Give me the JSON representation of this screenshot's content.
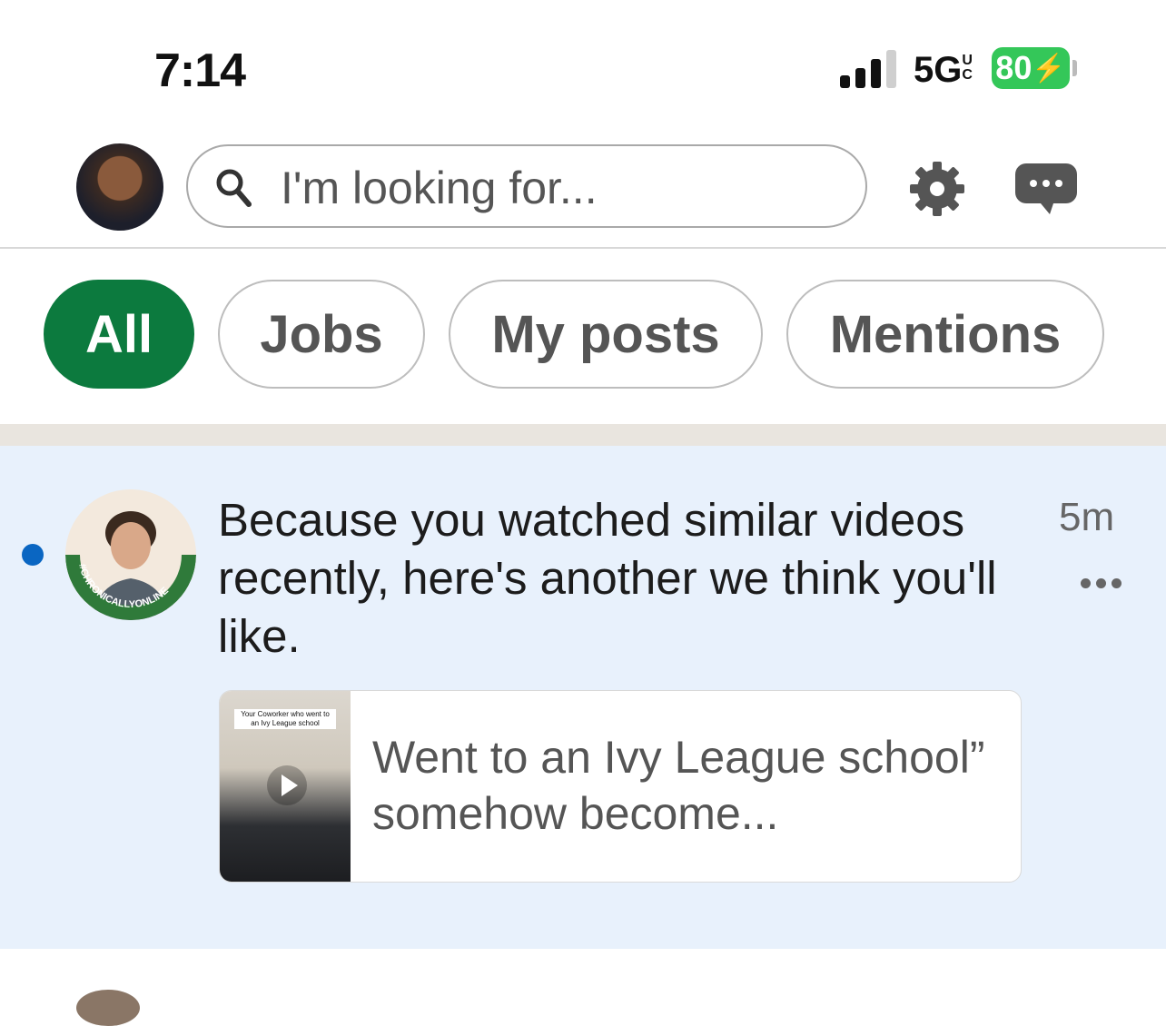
{
  "status_bar": {
    "time": "7:14",
    "network": "5G",
    "network_suffix": "UC",
    "battery": "80",
    "battery_color": "#34c759"
  },
  "topbar": {
    "search_placeholder": "I'm looking for...",
    "icons": [
      "avatar",
      "search-icon",
      "gear-icon",
      "messaging-icon"
    ]
  },
  "filters": {
    "accent": "#0c7a3e",
    "items": [
      {
        "label": "All",
        "active": true
      },
      {
        "label": "Jobs",
        "active": false
      },
      {
        "label": "My posts",
        "active": false
      },
      {
        "label": "Mentions",
        "active": false
      }
    ]
  },
  "notification": {
    "unread": true,
    "avatar_badge": "#CHRONICALLYONLINE",
    "text": "Because you watched similar videos recently, here's another we think you'll like.",
    "time": "5m",
    "preview": {
      "thumb_caption": "Your Coworker who went to an Ivy League school",
      "text": "Went to an Ivy League school” somehow become..."
    }
  }
}
